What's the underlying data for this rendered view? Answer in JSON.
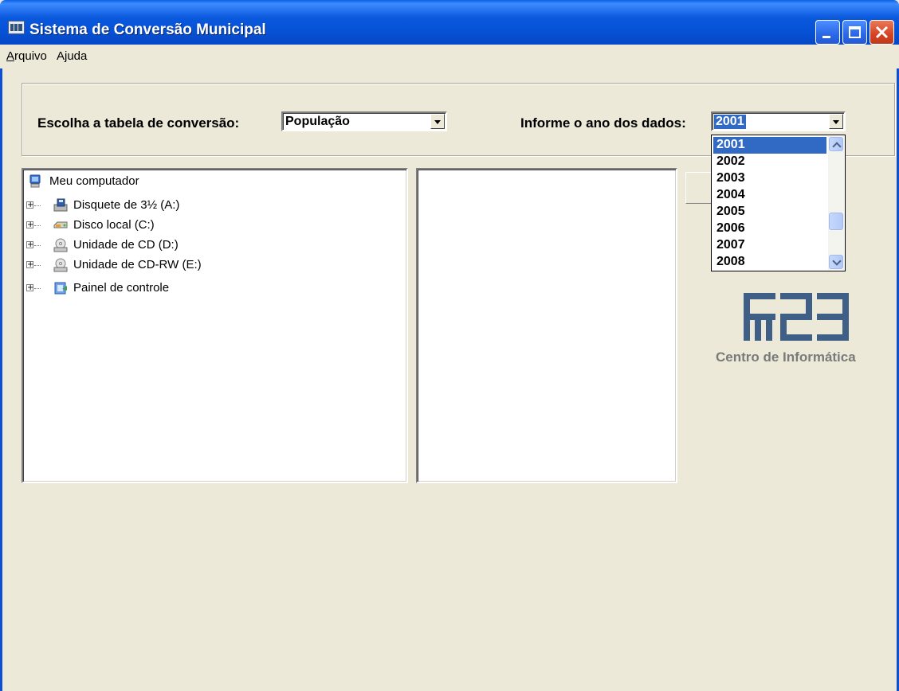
{
  "window": {
    "title": "Sistema de Conversão Municipal",
    "controls": [
      "minimize",
      "maximize",
      "close"
    ]
  },
  "menu": {
    "items": [
      {
        "underlined": "A",
        "rest": "rquivo"
      },
      {
        "underlined": "",
        "rest": "Ajuda"
      }
    ]
  },
  "form": {
    "table_label": "Escolha a tabela de conversão:",
    "table_value": "População",
    "year_label": "Informe o ano dos dados:",
    "year_value": "2001"
  },
  "year_options": [
    "2001",
    "2002",
    "2003",
    "2004",
    "2005",
    "2006",
    "2007",
    "2008"
  ],
  "tree": {
    "root": "Meu computador",
    "items": [
      {
        "label": "Disquete de 3½ (A:)",
        "icon": "floppy-drive-icon"
      },
      {
        "label": "Disco local (C:)",
        "icon": "hard-disk-icon"
      },
      {
        "label": "Unidade de CD (D:)",
        "icon": "cd-drive-icon"
      },
      {
        "label": "Unidade de CD-RW (E:)",
        "icon": "cd-rw-drive-icon"
      },
      {
        "label": "Painel de controle",
        "icon": "control-panel-icon"
      }
    ]
  },
  "logo": {
    "caption": "Centro de Informática",
    "color": "#3f5f86"
  }
}
